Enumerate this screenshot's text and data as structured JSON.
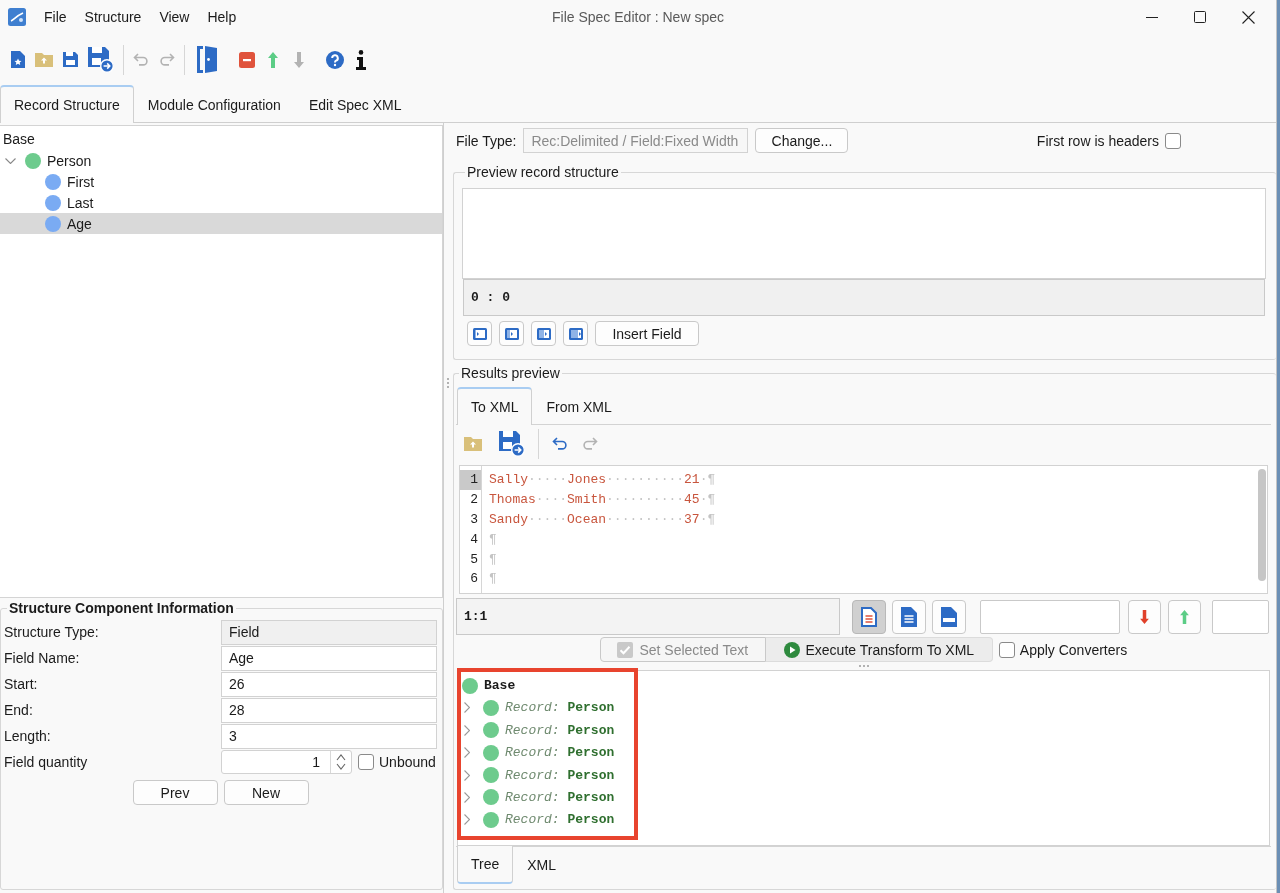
{
  "window": {
    "title": "File Spec Editor : New spec"
  },
  "menu": [
    "File",
    "Structure",
    "View",
    "Help"
  ],
  "toolbar": [
    {
      "kind": "new",
      "disabled": false
    },
    {
      "kind": "open",
      "disabled": false
    },
    {
      "kind": "save",
      "disabled": false
    },
    {
      "kind": "save-as",
      "disabled": false
    },
    {
      "kind": "separator"
    },
    {
      "kind": "undo",
      "disabled": true
    },
    {
      "kind": "redo",
      "disabled": true
    },
    {
      "kind": "separator"
    },
    {
      "kind": "exit",
      "disabled": false
    },
    {
      "kind": "delete",
      "disabled": false
    },
    {
      "kind": "move-up",
      "disabled": false
    },
    {
      "kind": "move-down",
      "disabled": true
    },
    {
      "kind": "help",
      "disabled": false
    },
    {
      "kind": "info",
      "disabled": false
    }
  ],
  "tabs": [
    {
      "label": "Record Structure",
      "selected": true
    },
    {
      "label": "Module Configuration",
      "selected": false
    },
    {
      "label": "Edit Spec XML",
      "selected": false
    }
  ],
  "structure_tree": {
    "root": "Base",
    "items": [
      {
        "label": "Person",
        "color": "#6dcb8d",
        "expanded": true,
        "selected": false,
        "children": [
          {
            "label": "First",
            "color": "#7aabf3",
            "selected": false
          },
          {
            "label": "Last",
            "color": "#7aabf3",
            "selected": false
          },
          {
            "label": "Age",
            "color": "#7aabf3",
            "selected": true
          }
        ]
      }
    ]
  },
  "component_info": {
    "title": "Structure Component Information",
    "fields": [
      {
        "label": "Structure Type:",
        "value": "Field",
        "disabled": true
      },
      {
        "label": "Field Name:",
        "value": "Age",
        "disabled": false
      },
      {
        "label": "Start:",
        "value": "26",
        "disabled": false
      },
      {
        "label": "End:",
        "value": "28",
        "disabled": false
      },
      {
        "label": "Length:",
        "value": "3",
        "disabled": false
      }
    ],
    "quantity": {
      "label": "Field quantity",
      "value": "1"
    },
    "unbound": {
      "label": "Unbound",
      "checked": false
    },
    "buttons": [
      "Prev",
      "New"
    ]
  },
  "file_type": {
    "label": "File Type:",
    "value": "Rec:Delimited / Field:Fixed Width",
    "disabled": true,
    "button": "Change...",
    "first_row_headers": {
      "label": "First row is headers",
      "checked": false
    }
  },
  "preview_structure": {
    "title": "Preview record structure",
    "position": "0 : 0",
    "insert_button": "Insert Field"
  },
  "results_preview": {
    "title": "Results preview",
    "tabs": [
      {
        "label": "To XML",
        "selected": true
      },
      {
        "label": "From XML",
        "selected": false
      }
    ],
    "toolbar": [
      {
        "kind": "open",
        "disabled": false
      },
      {
        "kind": "save-as",
        "disabled": false
      },
      {
        "kind": "separator"
      },
      {
        "kind": "undo",
        "disabled": false
      },
      {
        "kind": "redo",
        "disabled": true
      }
    ],
    "editor": {
      "lines": [
        {
          "number": "1",
          "current": true,
          "segments": [
            {
              "kind": "text",
              "text": "Sally"
            },
            {
              "kind": "space",
              "text": "·····"
            },
            {
              "kind": "text",
              "text": "Jones"
            },
            {
              "kind": "space",
              "text": "··········"
            },
            {
              "kind": "text",
              "text": "21"
            },
            {
              "kind": "space",
              "text": "·"
            },
            {
              "kind": "eol",
              "text": "¶"
            }
          ]
        },
        {
          "number": "2",
          "current": false,
          "segments": [
            {
              "kind": "text",
              "text": "Thomas"
            },
            {
              "kind": "space",
              "text": "····"
            },
            {
              "kind": "text",
              "text": "Smith"
            },
            {
              "kind": "space",
              "text": "··········"
            },
            {
              "kind": "text",
              "text": "45"
            },
            {
              "kind": "space",
              "text": "·"
            },
            {
              "kind": "eol",
              "text": "¶"
            }
          ]
        },
        {
          "number": "3",
          "current": false,
          "segments": [
            {
              "kind": "text",
              "text": "Sandy"
            },
            {
              "kind": "space",
              "text": "·····"
            },
            {
              "kind": "text",
              "text": "Ocean"
            },
            {
              "kind": "space",
              "text": "··········"
            },
            {
              "kind": "text",
              "text": "37"
            },
            {
              "kind": "space",
              "text": "·"
            },
            {
              "kind": "eol",
              "text": "¶"
            }
          ]
        },
        {
          "number": "4",
          "current": false,
          "segments": [
            {
              "kind": "eol",
              "text": "¶"
            }
          ]
        },
        {
          "number": "5",
          "current": false,
          "segments": [
            {
              "kind": "eol",
              "text": "¶"
            }
          ]
        },
        {
          "number": "6",
          "current": false,
          "segments": [
            {
              "kind": "eol",
              "text": "¶"
            }
          ]
        }
      ]
    },
    "cursor_position": "1:1",
    "view_buttons": [
      {
        "kind": "text",
        "selected": true
      },
      {
        "kind": "lines",
        "selected": false
      },
      {
        "kind": "html",
        "selected": false
      }
    ],
    "set_selected": {
      "label": "Set Selected Text",
      "disabled": true
    },
    "execute": {
      "label": "Execute Transform To XML"
    },
    "apply_converters": {
      "label": "Apply Converters",
      "checked": false
    },
    "result_tree": {
      "highlighted": true,
      "root": "Base",
      "records": [
        {
          "type": "Record:",
          "name": "Person",
          "expanded": false
        },
        {
          "type": "Record:",
          "name": "Person",
          "expanded": false
        },
        {
          "type": "Record:",
          "name": "Person",
          "expanded": false
        },
        {
          "type": "Record:",
          "name": "Person",
          "expanded": false
        },
        {
          "type": "Record:",
          "name": "Person",
          "expanded": false
        },
        {
          "type": "Record:",
          "name": "Person",
          "expanded": false
        }
      ]
    },
    "view_tabs": [
      {
        "label": "Tree",
        "selected": true
      },
      {
        "label": "XML",
        "selected": false
      }
    ]
  }
}
